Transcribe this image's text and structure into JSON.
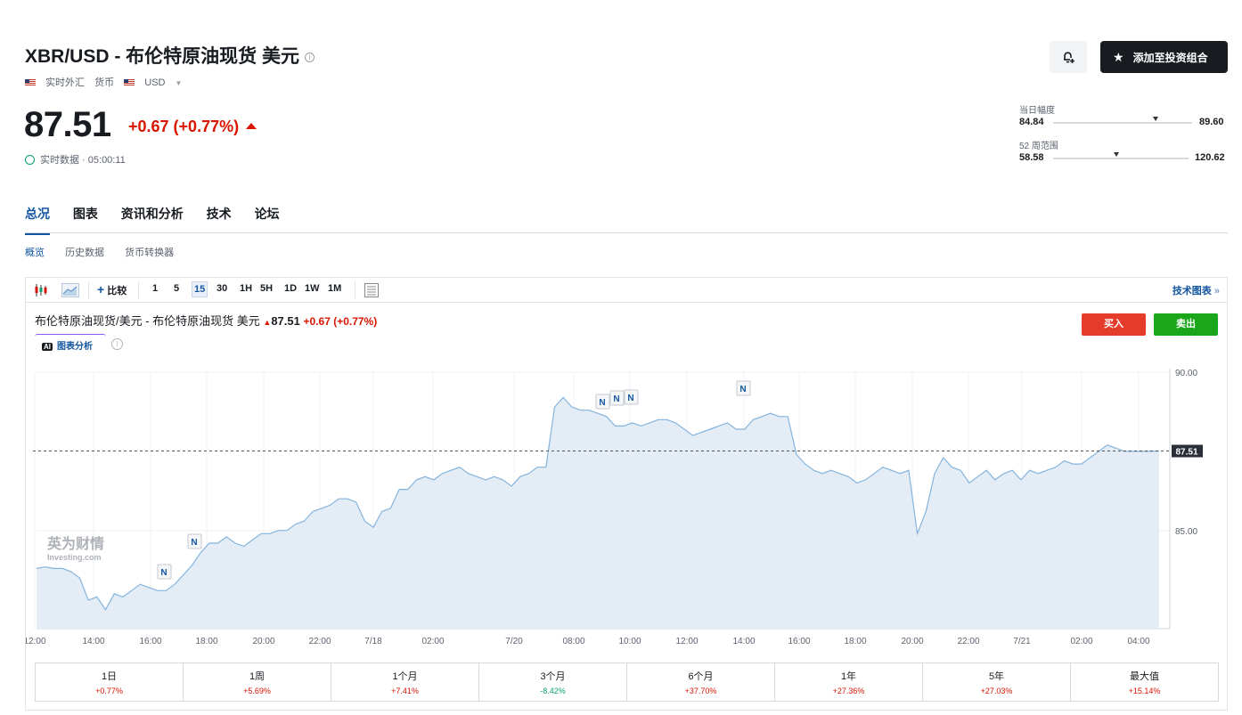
{
  "header": {
    "title": "XBR/USD - 布伦特原油现货 美元",
    "info_icon": "i",
    "meta": {
      "market": "实时外汇",
      "type": "货币",
      "currency": "USD"
    }
  },
  "quote": {
    "price": "87.51",
    "change": "+0.67 (+0.77%)",
    "realtime_label": "实时数据 · 05:00:11"
  },
  "actions": {
    "alert_icon": "bell-plus-icon",
    "portfolio_label": "添加至投资组合"
  },
  "ranges": {
    "day": {
      "label": "当日幅度",
      "low": "84.84",
      "high": "89.60",
      "position": 0.74
    },
    "week52": {
      "label": "52 周范围",
      "low": "58.58",
      "high": "120.62",
      "position": 0.47
    }
  },
  "tabs": [
    "总况",
    "图表",
    "资讯和分析",
    "技术",
    "论坛"
  ],
  "subtabs": [
    "概览",
    "历史数据",
    "货币转换器"
  ],
  "toolbar": {
    "compare": "比较",
    "intervals": [
      "1",
      "5",
      "15",
      "30",
      "1H",
      "5H",
      "1D",
      "1W",
      "1M"
    ],
    "selected_interval": "15",
    "tech_chart": "技术图表"
  },
  "chart_header": {
    "name": "布伦特原油现货/美元 - 布伦特原油现货 美元",
    "price": "87.51",
    "change": "+0.67 (+0.77%)",
    "ai_label": "图表分析",
    "buy": "买入",
    "sell": "卖出"
  },
  "watermark": {
    "cn": "英为财情",
    "en": "Investing.com"
  },
  "chart_data": {
    "type": "area",
    "x_ticks": [
      "12:00",
      "14:00",
      "16:00",
      "18:00",
      "20:00",
      "22:00",
      "7/18",
      "02:00",
      "7/20",
      "08:00",
      "10:00",
      "12:00",
      "14:00",
      "16:00",
      "18:00",
      "20:00",
      "22:00",
      "7/21",
      "02:00",
      "04:00"
    ],
    "y_ticks": [
      "90.00",
      "85.00"
    ],
    "ylim": [
      81.9,
      90.0
    ],
    "current_price": 87.51,
    "current_label": "87.51",
    "news_marker": "N",
    "series": [
      {
        "values": [
          83.8,
          83.85,
          83.8,
          83.8,
          83.7,
          83.5,
          82.8,
          82.9,
          82.5,
          83.0,
          82.9,
          83.1,
          83.3,
          83.2,
          83.1,
          83.1,
          83.3,
          83.6,
          83.9,
          84.3,
          84.6,
          84.6,
          84.8,
          84.6,
          84.5,
          84.7,
          84.9,
          84.9,
          85.0,
          85.0,
          85.2,
          85.3,
          85.6,
          85.7,
          85.8,
          86.0,
          86.0,
          85.9,
          85.3,
          85.1,
          85.6,
          85.7,
          86.3,
          86.3,
          86.6,
          86.7,
          86.6,
          86.8,
          86.9,
          87.0,
          86.8,
          86.7,
          86.6,
          86.7,
          86.6,
          86.4,
          86.7,
          86.8,
          87.0,
          87.0,
          88.9,
          89.2,
          88.9,
          88.8,
          88.8,
          88.7,
          88.6,
          88.3,
          88.3,
          88.4,
          88.3,
          88.4,
          88.5,
          88.5,
          88.4,
          88.2,
          88.0,
          88.1,
          88.2,
          88.3,
          88.4,
          88.2,
          88.2,
          88.5,
          88.6,
          88.7,
          88.6,
          88.6,
          87.4,
          87.1,
          86.9,
          86.8,
          86.9,
          86.8,
          86.7,
          86.5,
          86.6,
          86.8,
          87.0,
          86.9,
          86.8,
          86.9,
          84.9,
          85.6,
          86.8,
          87.3,
          87.0,
          86.9,
          86.5,
          86.7,
          86.9,
          86.6,
          86.8,
          86.9,
          86.6,
          86.9,
          86.8,
          86.9,
          87.0,
          87.2,
          87.1,
          87.1,
          87.3,
          87.5,
          87.7,
          87.6,
          87.5,
          87.5,
          87.5,
          87.5,
          87.51
        ]
      }
    ]
  },
  "performance": [
    {
      "label": "1日",
      "value": "+0.77%",
      "dir": "up"
    },
    {
      "label": "1周",
      "value": "+5.69%",
      "dir": "up"
    },
    {
      "label": "1个月",
      "value": "+7.41%",
      "dir": "up"
    },
    {
      "label": "3个月",
      "value": "-8.42%",
      "dir": "down"
    },
    {
      "label": "6个月",
      "value": "+37.70%",
      "dir": "up"
    },
    {
      "label": "1年",
      "value": "+27.36%",
      "dir": "up"
    },
    {
      "label": "5年",
      "value": "+27.03%",
      "dir": "up"
    },
    {
      "label": "最大值",
      "value": "+15.14%",
      "dir": "up"
    }
  ],
  "colors": {
    "accent": "#1256a0",
    "up": "#d91400",
    "down": "#0a9e6e",
    "buy": "#e43b2b",
    "sell": "#1aa61a",
    "line": "#84b4dd",
    "fill": "#e4edf6"
  }
}
